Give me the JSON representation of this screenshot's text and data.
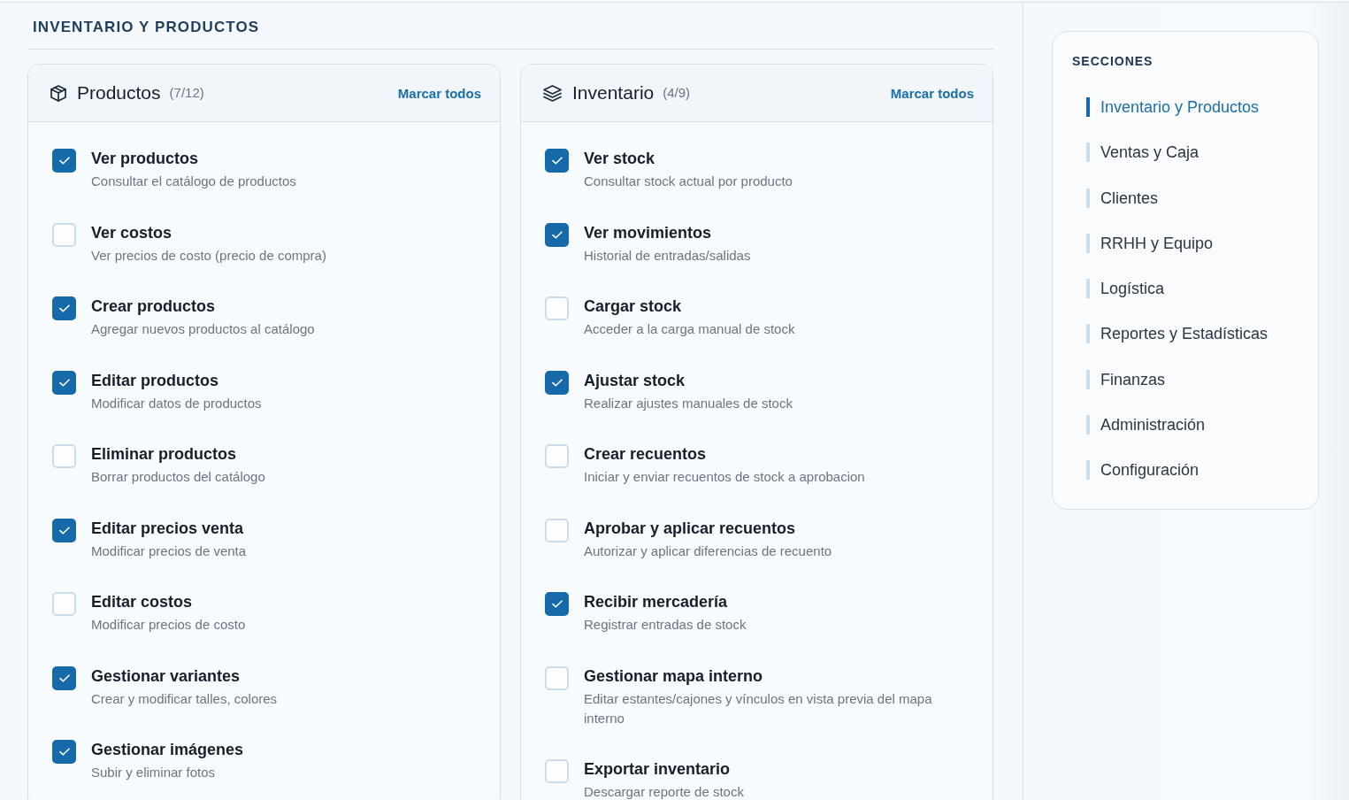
{
  "section_title": "INVENTARIO Y PRODUCTOS",
  "cards": [
    {
      "kind": "products",
      "title": "Productos",
      "count": "(7/12)",
      "action": "Marcar todos",
      "items": [
        {
          "title": "Ver productos",
          "description": "Consultar el catálogo de productos",
          "checked": true
        },
        {
          "title": "Ver costos",
          "description": "Ver precios de costo (precio de compra)",
          "checked": false
        },
        {
          "title": "Crear productos",
          "description": "Agregar nuevos productos al catálogo",
          "checked": true
        },
        {
          "title": "Editar productos",
          "description": "Modificar datos de productos",
          "checked": true
        },
        {
          "title": "Eliminar productos",
          "description": "Borrar productos del catálogo",
          "checked": false
        },
        {
          "title": "Editar precios venta",
          "description": "Modificar precios de venta",
          "checked": true
        },
        {
          "title": "Editar costos",
          "description": "Modificar precios de costo",
          "checked": false
        },
        {
          "title": "Gestionar variantes",
          "description": "Crear y modificar talles, colores",
          "checked": true
        },
        {
          "title": "Gestionar imágenes",
          "description": "Subir y eliminar fotos",
          "checked": true
        }
      ]
    },
    {
      "kind": "inventory",
      "title": "Inventario",
      "count": "(4/9)",
      "action": "Marcar todos",
      "items": [
        {
          "title": "Ver stock",
          "description": "Consultar stock actual por producto",
          "checked": true
        },
        {
          "title": "Ver movimientos",
          "description": "Historial de entradas/salidas",
          "checked": true
        },
        {
          "title": "Cargar stock",
          "description": "Acceder a la carga manual de stock",
          "checked": false
        },
        {
          "title": "Ajustar stock",
          "description": "Realizar ajustes manuales de stock",
          "checked": true
        },
        {
          "title": "Crear recuentos",
          "description": "Iniciar y enviar recuentos de stock a aprobacion",
          "checked": false
        },
        {
          "title": "Aprobar y aplicar recuentos",
          "description": "Autorizar y aplicar diferencias de recuento",
          "checked": false
        },
        {
          "title": "Recibir mercadería",
          "description": "Registrar entradas de stock",
          "checked": true
        },
        {
          "title": "Gestionar mapa interno",
          "description": "Editar estantes/cajones y vínculos en vista previa del mapa interno",
          "checked": false
        },
        {
          "title": "Exportar inventario",
          "description": "Descargar reporte de stock",
          "checked": false
        }
      ]
    }
  ],
  "sidebar": {
    "title": "SECCIONES",
    "items": [
      {
        "label": "Inventario y Productos",
        "selected": true
      },
      {
        "label": "Ventas y Caja",
        "selected": false
      },
      {
        "label": "Clientes",
        "selected": false
      },
      {
        "label": "RRHH y Equipo",
        "selected": false
      },
      {
        "label": "Logística",
        "selected": false
      },
      {
        "label": "Reportes y Estadísticas",
        "selected": false
      },
      {
        "label": "Finanzas",
        "selected": false
      },
      {
        "label": "Administración",
        "selected": false
      },
      {
        "label": "Configuración",
        "selected": false
      }
    ]
  }
}
